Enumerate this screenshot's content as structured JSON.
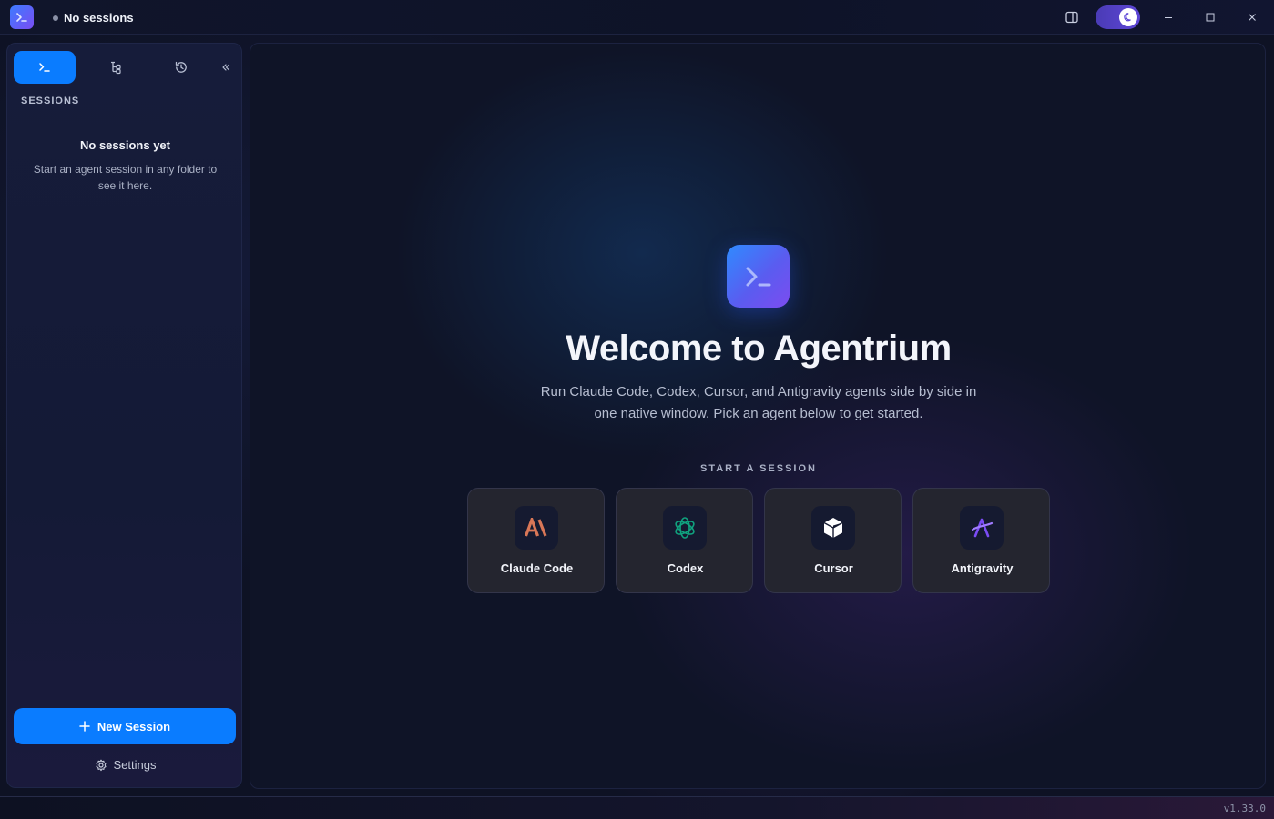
{
  "titlebar": {
    "session_status": "No sessions",
    "icons": [
      "app-logo-icon",
      "panel-toggle-icon",
      "moon-icon",
      "minimize-icon",
      "maximize-icon",
      "close-icon"
    ]
  },
  "sidebar": {
    "tabs": [
      {
        "name": "sessions",
        "icon": "terminal-icon",
        "active": true
      },
      {
        "name": "tree",
        "icon": "tree-icon",
        "active": false
      },
      {
        "name": "history",
        "icon": "history-icon",
        "active": false
      }
    ],
    "collapse_icon": "chevrons-left-icon",
    "sessions_heading": "SESSIONS",
    "empty_title": "No sessions yet",
    "empty_description": "Start an agent session in any folder to see it here.",
    "new_session_label": "New Session",
    "settings_label": "Settings"
  },
  "main": {
    "title": "Welcome to Agentrium",
    "subtitle": "Run Claude Code, Codex, Cursor, and Antigravity agents side by side in one native window. Pick an agent below to get started.",
    "start_heading": "START A SESSION",
    "agents": [
      {
        "label": "Claude Code",
        "icon": "claude-icon",
        "color": "#d97757"
      },
      {
        "label": "Codex",
        "icon": "openai-icon",
        "color": "#10a37f"
      },
      {
        "label": "Cursor",
        "icon": "cursor-icon",
        "color": "#ffffff"
      },
      {
        "label": "Antigravity",
        "icon": "antigravity-icon",
        "color": "#7b4cf5"
      }
    ]
  },
  "statusbar": {
    "version": "v1.33.0"
  },
  "colors": {
    "accent": "#0a7cff",
    "toggle": "#5d46d6",
    "background": "#0e1224"
  }
}
